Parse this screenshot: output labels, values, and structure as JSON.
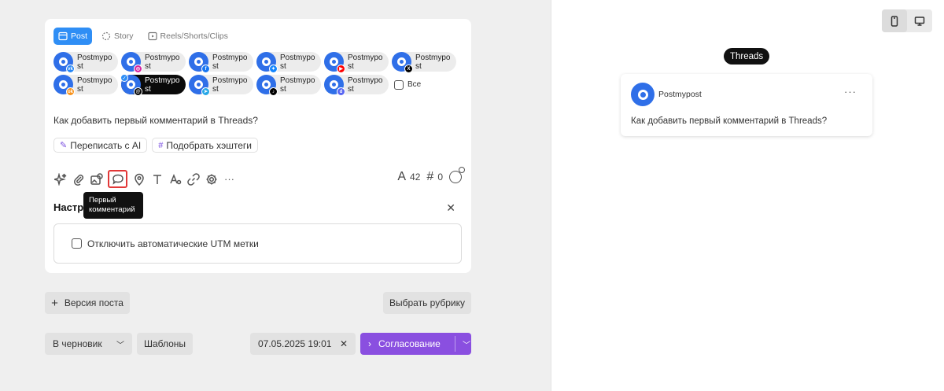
{
  "post_types": [
    {
      "label": "Post",
      "active": true,
      "icon": "post-icon"
    },
    {
      "label": "Story",
      "active": false,
      "icon": "story-icon"
    },
    {
      "label": "Reels/Shorts/Clips",
      "active": false,
      "icon": "reels-icon"
    }
  ],
  "accounts": [
    {
      "name": "Postmypost",
      "platform": "vk",
      "badge_color": "#2787f5",
      "badge_text": "vk",
      "selected": false
    },
    {
      "name": "Postmypost",
      "platform": "instagram",
      "badge_color": "#d6249f",
      "badge_text": "◎",
      "selected": false
    },
    {
      "name": "Postmypost",
      "platform": "facebook",
      "badge_color": "#1877f2",
      "badge_text": "f",
      "selected": false
    },
    {
      "name": "Postmypost",
      "platform": "bluesky",
      "badge_color": "#1185fe",
      "badge_text": "✦",
      "selected": false
    },
    {
      "name": "Postmypost",
      "platform": "youtube",
      "badge_color": "#ff0000",
      "badge_text": "▶",
      "selected": false
    },
    {
      "name": "Postmypost",
      "platform": "x",
      "badge_color": "#000000",
      "badge_text": "X",
      "selected": false
    },
    {
      "name": "Postmypost",
      "platform": "odnoklassniki",
      "badge_color": "#f7931e",
      "badge_text": "ok",
      "selected": false
    },
    {
      "name": "Postmypost",
      "platform": "threads",
      "badge_color": "#000000",
      "badge_text": "@",
      "selected": true
    },
    {
      "name": "Postmypost",
      "platform": "telegram",
      "badge_color": "#27a7e7",
      "badge_text": "➤",
      "selected": false
    },
    {
      "name": "Postmypost",
      "platform": "tiktok",
      "badge_color": "#000000",
      "badge_text": "♪",
      "selected": false
    },
    {
      "name": "Postmypost",
      "platform": "discord",
      "badge_color": "#5865f2",
      "badge_text": "d",
      "selected": false
    }
  ],
  "select_all_label": "Все",
  "post_text": "Как добавить первый комментарий в Threads?",
  "ai_actions": {
    "rewrite_label": "Переписать с AI",
    "hashtags_label": "Подобрать хэштеги"
  },
  "counters": {
    "chars": "42",
    "hashtags": "0"
  },
  "tooltip": {
    "line1": "Первый",
    "line2": "комментарий"
  },
  "settings": {
    "title": "Настройки",
    "utm_label": "Отключить автоматические UTM метки"
  },
  "buttons": {
    "version": "Версия поста",
    "rubric": "Выбрать рубрику",
    "draft": "В черновик",
    "templates": "Шаблоны",
    "date": "07.05.2025 19:01",
    "approve": "Согласование"
  },
  "preview": {
    "platform": "Threads",
    "account_name": "Postmypost",
    "text": "Как добавить первый комментарий в Threads?"
  },
  "colors": {
    "accent_blue": "#2f8ef5",
    "approve_purple": "#8a4fe0",
    "avatar_blue": "#2f6fe8",
    "highlight_red": "#e23838"
  }
}
